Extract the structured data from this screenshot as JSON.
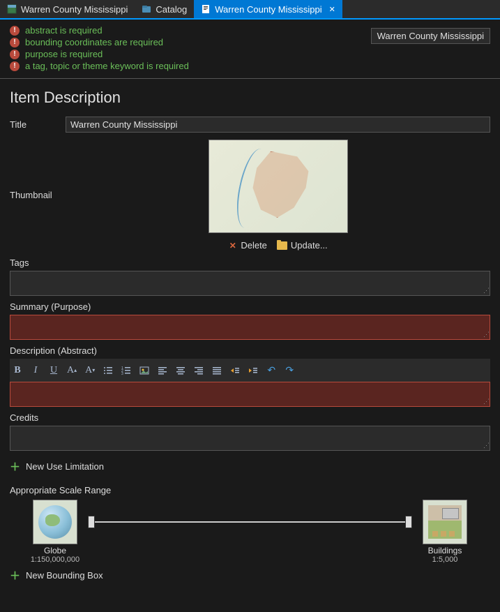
{
  "tabs": [
    {
      "label": "Warren County Mississippi",
      "icon": "map-icon",
      "active": false
    },
    {
      "label": "Catalog",
      "icon": "catalog-icon",
      "active": false
    },
    {
      "label": "Warren County Mississippi",
      "icon": "metadata-icon",
      "active": true
    }
  ],
  "validation": {
    "messages": [
      "abstract is required",
      "bounding coordinates are required",
      "purpose is required",
      "a tag, topic or theme keyword is required"
    ],
    "tooltip": "Warren County Mississippi"
  },
  "section": {
    "heading": "Item Description",
    "title_label": "Title",
    "title_value": "Warren County Mississippi",
    "thumbnail_label": "Thumbnail",
    "delete_label": "Delete",
    "update_label": "Update...",
    "tags_label": "Tags",
    "summary_label": "Summary (Purpose)",
    "description_label": "Description (Abstract)",
    "credits_label": "Credits",
    "new_use_limitation_label": "New Use Limitation",
    "scale_range_label": "Appropriate Scale Range",
    "new_bounding_box_label": "New Bounding Box"
  },
  "scale": {
    "min_caption": "Globe",
    "min_value": "1:150,000,000",
    "max_caption": "Buildings",
    "max_value": "1:5,000"
  },
  "rte_buttons": [
    "B",
    "I",
    "U",
    "A-size-up",
    "A-size-down",
    "list-ul",
    "list-ol",
    "image",
    "align-left",
    "align-center",
    "align-right",
    "align-justify",
    "indent-right",
    "indent-left",
    "undo",
    "redo"
  ]
}
